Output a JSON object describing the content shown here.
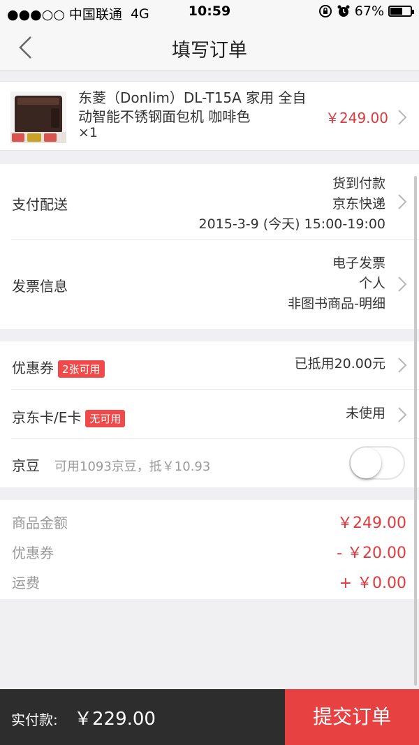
{
  "status_bar": {
    "carrier": "●●●○○ 中国联通",
    "network": "4G",
    "time": "10:59",
    "battery": "67%",
    "battery_level": 0.67
  },
  "nav": {
    "title": "填写订单"
  },
  "product": {
    "title": "东菱（Donlim）DL-T15A 家用 全自动智能不锈钢面包机 咖啡色",
    "qty": "×1",
    "price": "￥249.00"
  },
  "delivery": {
    "label": "支付配送",
    "payment": "货到付款",
    "courier": "京东快递",
    "time": "2015-3-9 (今天) 15:00-19:00"
  },
  "invoice": {
    "label": "发票信息",
    "type": "电子发票",
    "title": "个人",
    "content": "非图书商品-明细"
  },
  "coupon": {
    "label": "优惠券",
    "tag": "2张可用",
    "value": "已抵用20.00元"
  },
  "jdcard": {
    "label": "京东卡/E卡",
    "tag": "无可用",
    "value": "未使用"
  },
  "jingdou": {
    "label": "京豆",
    "hint": "可用1093京豆，抵￥10.93",
    "enabled": false
  },
  "summary": {
    "items": [
      {
        "label": "商品金额",
        "value": "￥249.00"
      },
      {
        "label": "优惠券",
        "value": "- ￥20.00"
      },
      {
        "label": "运费",
        "value": "+ ￥0.00"
      }
    ]
  },
  "footer": {
    "pay_label": "实付款:",
    "pay_amount": "￥229.00",
    "submit_label": "提交订单"
  },
  "colors": {
    "accent": "#e4393c",
    "tag": "#f04a4a",
    "bottom_bar": "#2d2d2d",
    "submit": "#e84142"
  }
}
